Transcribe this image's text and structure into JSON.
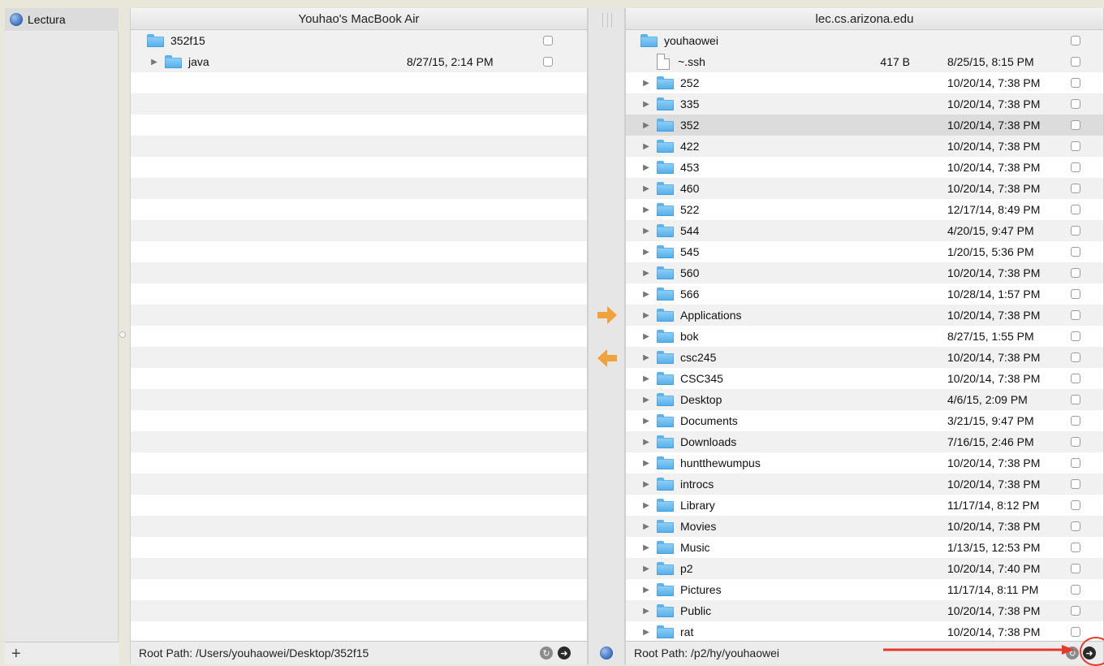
{
  "sidebar": {
    "item_label": "Lectura",
    "add_label": "+"
  },
  "left_panel": {
    "title": "Youhao's MacBook Air",
    "root_label": "352f15",
    "rows": [
      {
        "name": "java",
        "date": "8/27/15, 2:14 PM",
        "type": "folder"
      }
    ],
    "footer_path": "Root Path: /Users/youhaowei/Desktop/352f15"
  },
  "right_panel": {
    "title": "lec.cs.arizona.edu",
    "root_label": "youhaowei",
    "rows": [
      {
        "name": "~.ssh",
        "size": "417 B",
        "date": "8/25/15, 8:15 PM",
        "type": "file"
      },
      {
        "name": "252",
        "date": "10/20/14, 7:38 PM",
        "type": "folder"
      },
      {
        "name": "335",
        "date": "10/20/14, 7:38 PM",
        "type": "folder"
      },
      {
        "name": "352",
        "date": "10/20/14, 7:38 PM",
        "type": "folder",
        "selected": true
      },
      {
        "name": "422",
        "date": "10/20/14, 7:38 PM",
        "type": "folder"
      },
      {
        "name": "453",
        "date": "10/20/14, 7:38 PM",
        "type": "folder"
      },
      {
        "name": "460",
        "date": "10/20/14, 7:38 PM",
        "type": "folder"
      },
      {
        "name": "522",
        "date": "12/17/14, 8:49 PM",
        "type": "folder"
      },
      {
        "name": "544",
        "date": "4/20/15, 9:47 PM",
        "type": "folder"
      },
      {
        "name": "545",
        "date": "1/20/15, 5:36 PM",
        "type": "folder"
      },
      {
        "name": "560",
        "date": "10/20/14, 7:38 PM",
        "type": "folder"
      },
      {
        "name": "566",
        "date": "10/28/14, 1:57 PM",
        "type": "folder"
      },
      {
        "name": "Applications",
        "date": "10/20/14, 7:38 PM",
        "type": "folder"
      },
      {
        "name": "bok",
        "date": "8/27/15, 1:55 PM",
        "type": "folder"
      },
      {
        "name": "csc245",
        "date": "10/20/14, 7:38 PM",
        "type": "folder"
      },
      {
        "name": "CSC345",
        "date": "10/20/14, 7:38 PM",
        "type": "folder"
      },
      {
        "name": "Desktop",
        "date": "4/6/15, 2:09 PM",
        "type": "folder"
      },
      {
        "name": "Documents",
        "date": "3/21/15, 9:47 PM",
        "type": "folder"
      },
      {
        "name": "Downloads",
        "date": "7/16/15, 2:46 PM",
        "type": "folder"
      },
      {
        "name": "huntthewumpus",
        "date": "10/20/14, 7:38 PM",
        "type": "folder"
      },
      {
        "name": "introcs",
        "date": "10/20/14, 7:38 PM",
        "type": "folder"
      },
      {
        "name": "Library",
        "date": "11/17/14, 8:12 PM",
        "type": "folder"
      },
      {
        "name": "Movies",
        "date": "10/20/14, 7:38 PM",
        "type": "folder"
      },
      {
        "name": "Music",
        "date": "1/13/15, 12:53 PM",
        "type": "folder"
      },
      {
        "name": "p2",
        "date": "10/20/14, 7:40 PM",
        "type": "folder"
      },
      {
        "name": "Pictures",
        "date": "11/17/14, 8:11 PM",
        "type": "folder"
      },
      {
        "name": "Public",
        "date": "10/20/14, 7:38 PM",
        "type": "folder"
      },
      {
        "name": "rat",
        "date": "10/20/14, 7:38 PM",
        "type": "folder"
      }
    ],
    "footer_path": "Root Path: /p2/hy/youhaowei"
  },
  "colors": {
    "transfer_arrow": "#f1a23a",
    "annotation_red": "#e43a2c",
    "folder_blue": "#5fb3ec",
    "selected_row": "#dcdcdc"
  },
  "icons": {
    "server": "globe-icon",
    "transfer_right": "arrow-right-icon",
    "transfer_left": "arrow-left-icon",
    "refresh": "refresh-icon",
    "go": "go-arrow-icon"
  }
}
